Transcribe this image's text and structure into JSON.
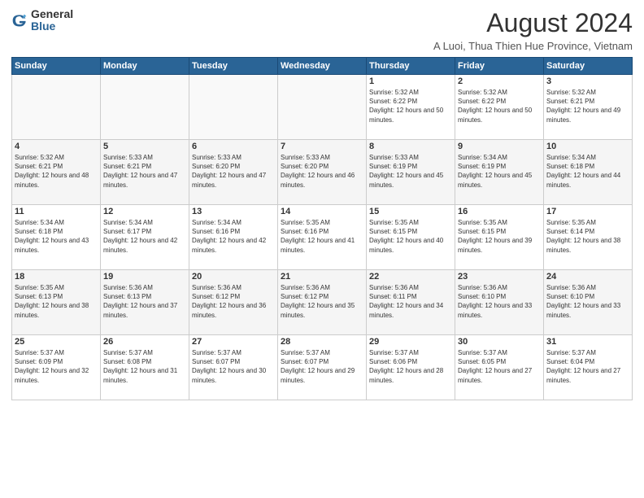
{
  "header": {
    "logo_general": "General",
    "logo_blue": "Blue",
    "month_year": "August 2024",
    "location": "A Luoi, Thua Thien Hue Province, Vietnam"
  },
  "weekdays": [
    "Sunday",
    "Monday",
    "Tuesday",
    "Wednesday",
    "Thursday",
    "Friday",
    "Saturday"
  ],
  "rows": [
    {
      "cells": [
        {
          "day": "",
          "empty": true
        },
        {
          "day": "",
          "empty": true
        },
        {
          "day": "",
          "empty": true
        },
        {
          "day": "",
          "empty": true
        },
        {
          "day": "1",
          "sunrise": "5:32 AM",
          "sunset": "6:22 PM",
          "daylight": "12 hours and 50 minutes."
        },
        {
          "day": "2",
          "sunrise": "5:32 AM",
          "sunset": "6:22 PM",
          "daylight": "12 hours and 50 minutes."
        },
        {
          "day": "3",
          "sunrise": "5:32 AM",
          "sunset": "6:21 PM",
          "daylight": "12 hours and 49 minutes."
        }
      ]
    },
    {
      "cells": [
        {
          "day": "4",
          "sunrise": "5:32 AM",
          "sunset": "6:21 PM",
          "daylight": "12 hours and 48 minutes."
        },
        {
          "day": "5",
          "sunrise": "5:33 AM",
          "sunset": "6:21 PM",
          "daylight": "12 hours and 47 minutes."
        },
        {
          "day": "6",
          "sunrise": "5:33 AM",
          "sunset": "6:20 PM",
          "daylight": "12 hours and 47 minutes."
        },
        {
          "day": "7",
          "sunrise": "5:33 AM",
          "sunset": "6:20 PM",
          "daylight": "12 hours and 46 minutes."
        },
        {
          "day": "8",
          "sunrise": "5:33 AM",
          "sunset": "6:19 PM",
          "daylight": "12 hours and 45 minutes."
        },
        {
          "day": "9",
          "sunrise": "5:34 AM",
          "sunset": "6:19 PM",
          "daylight": "12 hours and 45 minutes."
        },
        {
          "day": "10",
          "sunrise": "5:34 AM",
          "sunset": "6:18 PM",
          "daylight": "12 hours and 44 minutes."
        }
      ]
    },
    {
      "cells": [
        {
          "day": "11",
          "sunrise": "5:34 AM",
          "sunset": "6:18 PM",
          "daylight": "12 hours and 43 minutes."
        },
        {
          "day": "12",
          "sunrise": "5:34 AM",
          "sunset": "6:17 PM",
          "daylight": "12 hours and 42 minutes."
        },
        {
          "day": "13",
          "sunrise": "5:34 AM",
          "sunset": "6:16 PM",
          "daylight": "12 hours and 42 minutes."
        },
        {
          "day": "14",
          "sunrise": "5:35 AM",
          "sunset": "6:16 PM",
          "daylight": "12 hours and 41 minutes."
        },
        {
          "day": "15",
          "sunrise": "5:35 AM",
          "sunset": "6:15 PM",
          "daylight": "12 hours and 40 minutes."
        },
        {
          "day": "16",
          "sunrise": "5:35 AM",
          "sunset": "6:15 PM",
          "daylight": "12 hours and 39 minutes."
        },
        {
          "day": "17",
          "sunrise": "5:35 AM",
          "sunset": "6:14 PM",
          "daylight": "12 hours and 38 minutes."
        }
      ]
    },
    {
      "cells": [
        {
          "day": "18",
          "sunrise": "5:35 AM",
          "sunset": "6:13 PM",
          "daylight": "12 hours and 38 minutes."
        },
        {
          "day": "19",
          "sunrise": "5:36 AM",
          "sunset": "6:13 PM",
          "daylight": "12 hours and 37 minutes."
        },
        {
          "day": "20",
          "sunrise": "5:36 AM",
          "sunset": "6:12 PM",
          "daylight": "12 hours and 36 minutes."
        },
        {
          "day": "21",
          "sunrise": "5:36 AM",
          "sunset": "6:12 PM",
          "daylight": "12 hours and 35 minutes."
        },
        {
          "day": "22",
          "sunrise": "5:36 AM",
          "sunset": "6:11 PM",
          "daylight": "12 hours and 34 minutes."
        },
        {
          "day": "23",
          "sunrise": "5:36 AM",
          "sunset": "6:10 PM",
          "daylight": "12 hours and 33 minutes."
        },
        {
          "day": "24",
          "sunrise": "5:36 AM",
          "sunset": "6:10 PM",
          "daylight": "12 hours and 33 minutes."
        }
      ]
    },
    {
      "cells": [
        {
          "day": "25",
          "sunrise": "5:37 AM",
          "sunset": "6:09 PM",
          "daylight": "12 hours and 32 minutes."
        },
        {
          "day": "26",
          "sunrise": "5:37 AM",
          "sunset": "6:08 PM",
          "daylight": "12 hours and 31 minutes."
        },
        {
          "day": "27",
          "sunrise": "5:37 AM",
          "sunset": "6:07 PM",
          "daylight": "12 hours and 30 minutes."
        },
        {
          "day": "28",
          "sunrise": "5:37 AM",
          "sunset": "6:07 PM",
          "daylight": "12 hours and 29 minutes."
        },
        {
          "day": "29",
          "sunrise": "5:37 AM",
          "sunset": "6:06 PM",
          "daylight": "12 hours and 28 minutes."
        },
        {
          "day": "30",
          "sunrise": "5:37 AM",
          "sunset": "6:05 PM",
          "daylight": "12 hours and 27 minutes."
        },
        {
          "day": "31",
          "sunrise": "5:37 AM",
          "sunset": "6:04 PM",
          "daylight": "12 hours and 27 minutes."
        }
      ]
    }
  ]
}
